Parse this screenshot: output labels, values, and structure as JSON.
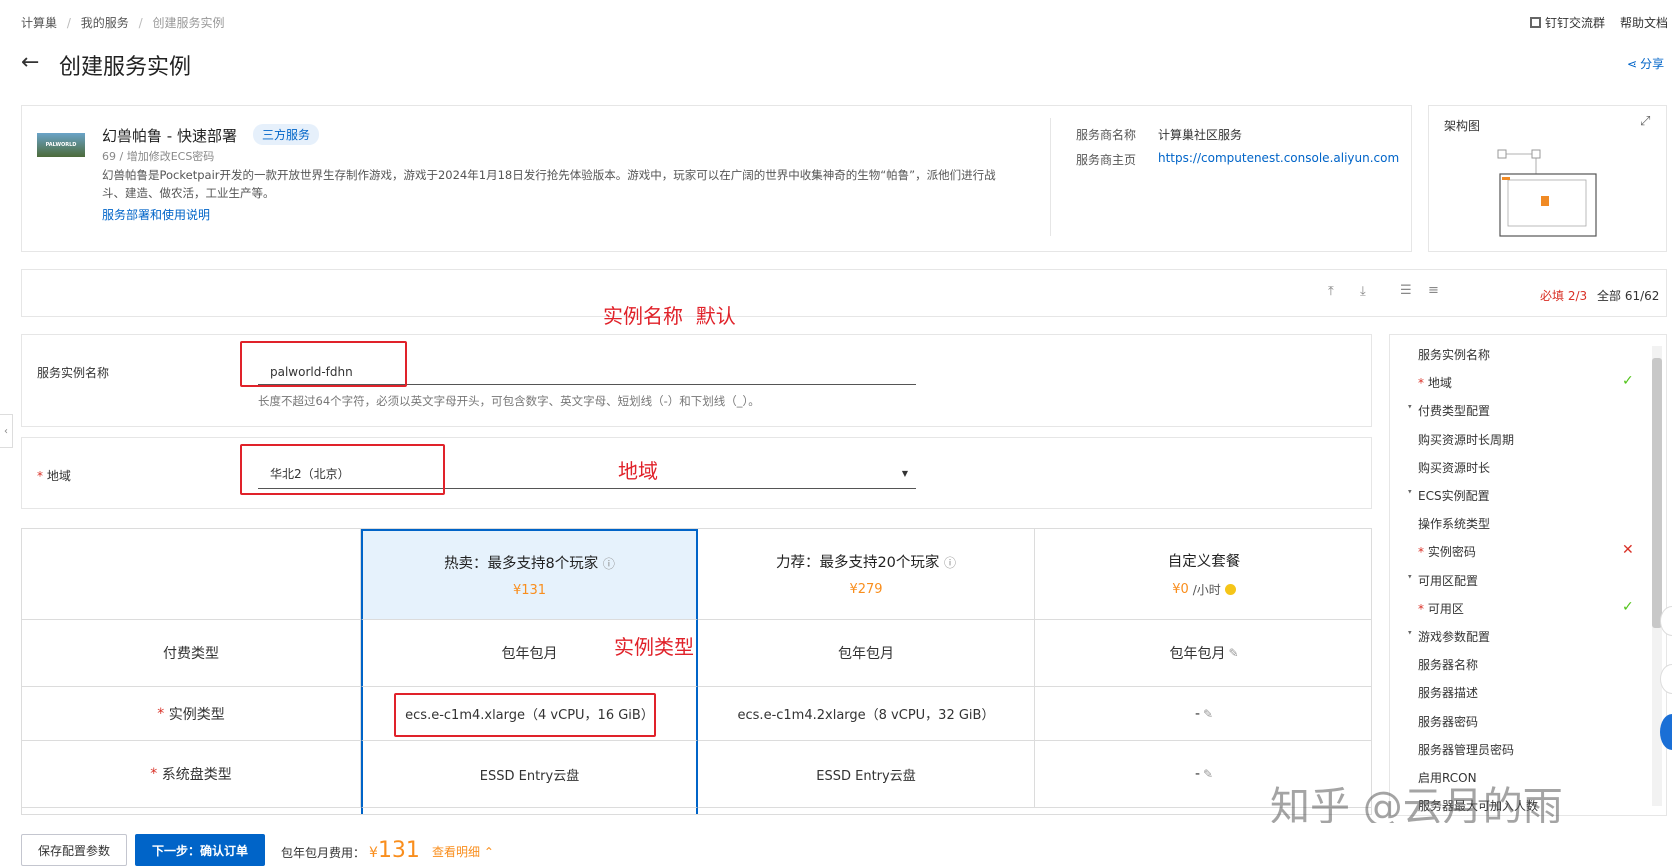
{
  "breadcrumb": [
    "计算巢",
    "我的服务",
    "创建服务实例"
  ],
  "top_links": {
    "dingtalk": "钉钉交流群",
    "help": "帮助文档",
    "share": "分享"
  },
  "page_title": "创建服务实例",
  "service": {
    "name": "幻兽帕鲁 - 快速部署",
    "badge": "三方服务",
    "meta": "69 / 增加修改ECS密码",
    "desc_line1": "幻兽帕鲁是Pocketpair开发的一款开放世界生存制作游戏，游戏于2024年1月18日发行抢先体验版本。游戏中，玩家可以在广阔的世界中收集神奇的生物“帕鲁”，派他们进行战",
    "desc_line2": "斗、建造、做农活，工业生产等。",
    "doc_link": "服务部署和使用说明",
    "thumb_text": "PALWORLD",
    "provider_label": "服务商名称",
    "provider_value": "计算巢社区服务",
    "homepage_label": "服务商主页",
    "homepage_value": "https://computenest.console.aliyun.com"
  },
  "arch": {
    "title": "架构图"
  },
  "progress": {
    "required_label": "必填",
    "required_value": "2/3",
    "all_label": "全部",
    "all_value": "61/62"
  },
  "annotations": {
    "instance_name": "实例名称  默认",
    "region": "地域",
    "instance_type": "实例类型"
  },
  "form": {
    "instance_name_label": "服务实例名称",
    "instance_name_value": "palworld-fdhn",
    "instance_name_help": "长度不超过64个字符，必须以英文字母开头，可包含数字、英文字母、短划线（-）和下划线（_）。",
    "region_label": "地域",
    "region_value": "华北2（北京）"
  },
  "plans": [
    {
      "name": "热卖：最多支持8个玩家",
      "price": "¥131"
    },
    {
      "name": "力荐：最多支持20个玩家",
      "price": "¥279"
    },
    {
      "name": "自定义套餐",
      "price": "¥0",
      "unit": "/小时"
    }
  ],
  "rows": [
    {
      "label": "付费类型",
      "values": [
        "包年包月",
        "包年包月",
        "包年包月"
      ],
      "required": false
    },
    {
      "label": "实例类型",
      "values": [
        "ecs.e-c1m4.xlarge（4 vCPU，16 GiB）",
        "ecs.e-c1m4.2xlarge（8 vCPU，32 GiB）",
        "-"
      ],
      "required": true
    },
    {
      "label": "系统盘类型",
      "values": [
        "ESSD Entry云盘",
        "ESSD Entry云盘",
        "-"
      ],
      "required": true
    }
  ],
  "nav": [
    {
      "label": "服务实例名称",
      "level": 1,
      "required": false,
      "status": ""
    },
    {
      "label": "地域",
      "level": 1,
      "required": true,
      "status": "ok"
    },
    {
      "label": "付费类型配置",
      "level": 0,
      "required": false,
      "status": ""
    },
    {
      "label": "购买资源时长周期",
      "level": 1,
      "required": false,
      "status": ""
    },
    {
      "label": "购买资源时长",
      "level": 1,
      "required": false,
      "status": ""
    },
    {
      "label": "ECS实例配置",
      "level": 0,
      "required": false,
      "status": ""
    },
    {
      "label": "操作系统类型",
      "level": 1,
      "required": false,
      "status": ""
    },
    {
      "label": "实例密码",
      "level": 1,
      "required": true,
      "status": "err"
    },
    {
      "label": "可用区配置",
      "level": 0,
      "required": false,
      "status": ""
    },
    {
      "label": "可用区",
      "level": 1,
      "required": true,
      "status": "ok"
    },
    {
      "label": "游戏参数配置",
      "level": 0,
      "required": false,
      "status": ""
    },
    {
      "label": "服务器名称",
      "level": 1,
      "required": false,
      "status": ""
    },
    {
      "label": "服务器描述",
      "level": 1,
      "required": false,
      "status": ""
    },
    {
      "label": "服务器密码",
      "level": 1,
      "required": false,
      "status": ""
    },
    {
      "label": "服务器管理员密码",
      "level": 1,
      "required": false,
      "status": ""
    },
    {
      "label": "启用RCON",
      "level": 1,
      "required": false,
      "status": ""
    },
    {
      "label": "服务器最大可加入人数",
      "level": 1,
      "required": false,
      "status": ""
    }
  ],
  "footer": {
    "save": "保存配置参数",
    "next": "下一步：确认订单",
    "fee_label": "包年包月费用：",
    "fee_currency": "¥",
    "fee_value": "131",
    "detail": "查看明细"
  },
  "watermark": "知乎 @云月的雨",
  "colors": {
    "primary": "#0064c8",
    "annotation": "#e0222a",
    "price": "#f98e1d",
    "ok": "#52c41a",
    "err": "#d93026"
  }
}
